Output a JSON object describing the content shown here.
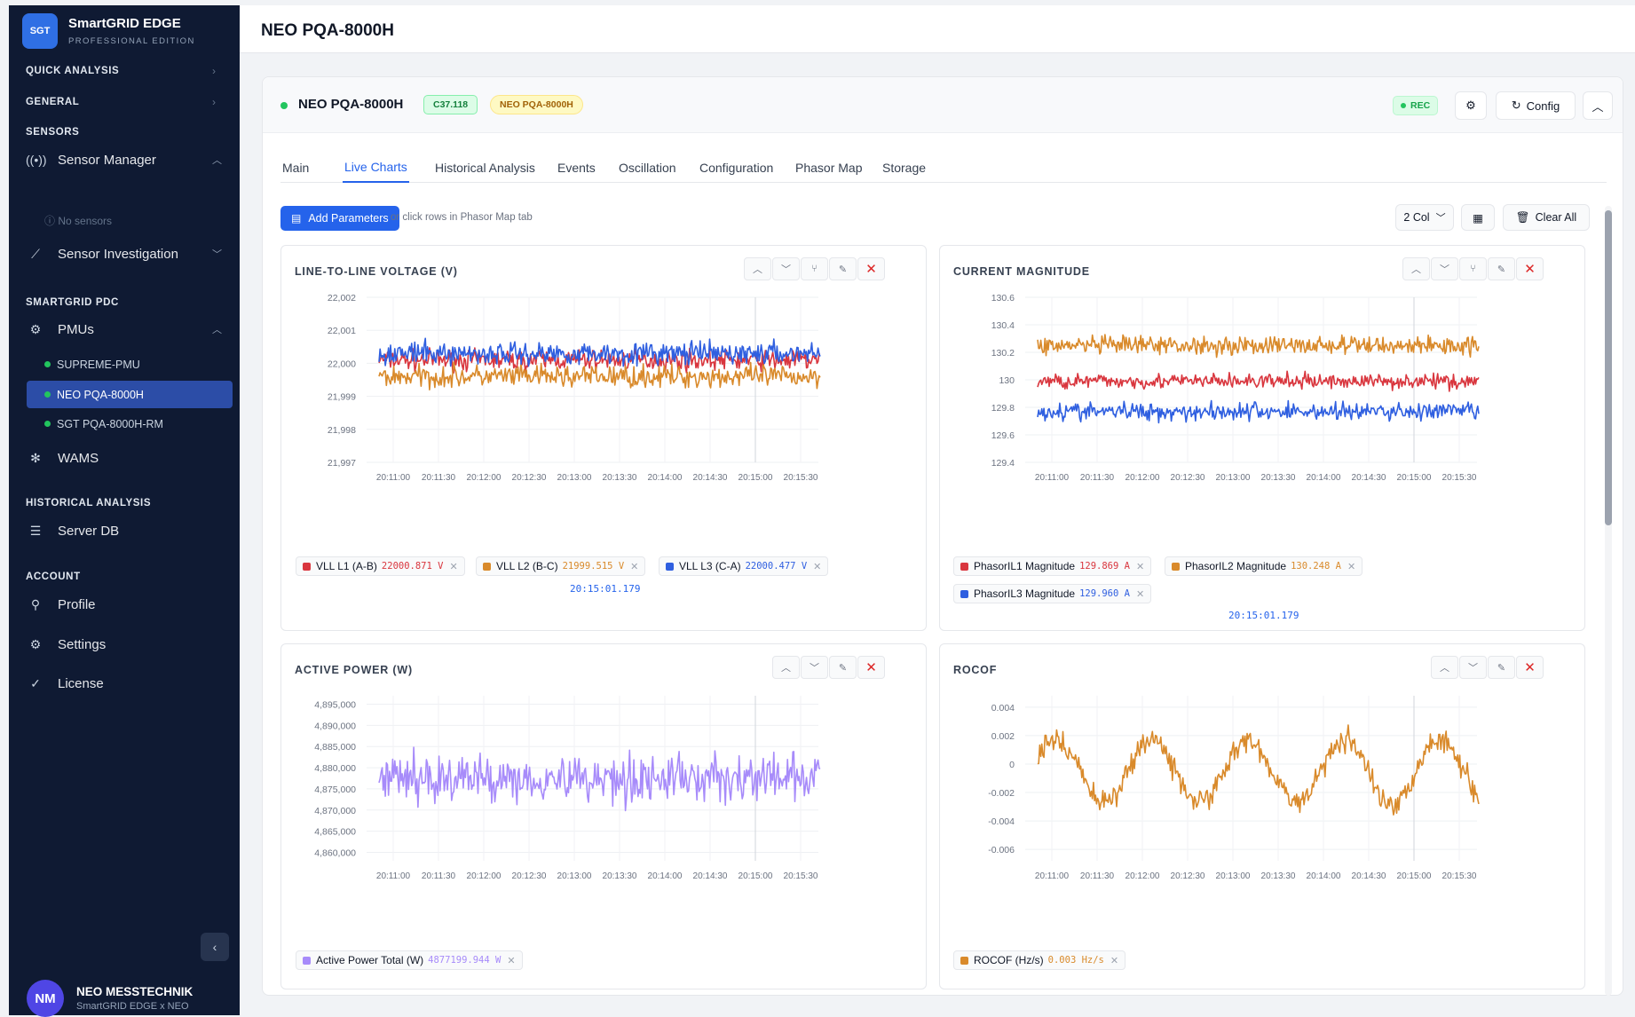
{
  "brand": {
    "logo": "SGT",
    "name": "SmartGRID EDGE",
    "edition": "PROFESSIONAL EDITION"
  },
  "sidebar": {
    "quick_analysis": "QUICK ANALYSIS",
    "general": "GENERAL",
    "sensors_header": "SENSORS",
    "sensor_manager": "Sensor Manager",
    "no_sensors": "No sensors",
    "sensor_investigation": "Sensor Investigation",
    "pdc_header": "SMARTGRID PDC",
    "pmus": "PMUs",
    "pmu_items": [
      "SUPREME-PMU",
      "NEO PQA-8000H",
      "SGT PQA-8000H-RM"
    ],
    "wams": "WAMS",
    "hist_header": "HISTORICAL ANALYSIS",
    "server_db": "Server DB",
    "account_header": "ACCOUNT",
    "profile": "Profile",
    "settings": "Settings",
    "license": "License"
  },
  "user": {
    "initials": "NM",
    "name": "NEO MESSTECHNIK",
    "subtitle": "SmartGRID EDGE x NEO"
  },
  "header": {
    "title": "NEO PQA-8000H"
  },
  "device": {
    "name": "NEO PQA-8000H",
    "protocol_badge": "C37.118",
    "device_badge": "NEO PQA-8000H",
    "rec": "REC",
    "config": "Config"
  },
  "tabs": [
    "Main",
    "Live Charts",
    "Historical Analysis",
    "Events",
    "Oscillation",
    "Configuration",
    "Phasor Map",
    "Storage"
  ],
  "active_tab": "Live Charts",
  "toolbar": {
    "add_parameters": "Add Parameters",
    "hint": "or click rows in Phasor Map tab",
    "columns": "2 Col",
    "clear_all": "Clear All"
  },
  "x_ticks": [
    "20:11:00",
    "20:11:30",
    "20:12:00",
    "20:12:30",
    "20:13:00",
    "20:13:30",
    "20:14:00",
    "20:14:30",
    "20:15:00",
    "20:15:30"
  ],
  "colors": {
    "red": "#d9363e",
    "orange": "#d98a2b",
    "blue": "#2f5fe0",
    "purple": "#a78bfa",
    "accent": "#2563eb"
  },
  "chart_data": [
    {
      "type": "line",
      "title": "LINE-TO-LINE VOLTAGE (V)",
      "ylim": [
        21997,
        22002
      ],
      "y_ticks": [
        "22,002",
        "22,001",
        "22,000",
        "21,999",
        "21,998",
        "21,997"
      ],
      "series": [
        {
          "name": "VLL L1 (A-B)",
          "value": "22000.871",
          "unit": "V",
          "color": "#d9363e",
          "center": 22000.1,
          "spread": 0.45
        },
        {
          "name": "VLL L2 (B-C)",
          "value": "21999.515",
          "unit": "V",
          "color": "#d98a2b",
          "center": 21999.6,
          "spread": 0.5
        },
        {
          "name": "VLL L3 (C-A)",
          "value": "22000.477",
          "unit": "V",
          "color": "#2f5fe0",
          "center": 22000.3,
          "spread": 0.5
        }
      ],
      "timestamp": "20:15:01.179"
    },
    {
      "type": "line",
      "title": "CURRENT MAGNITUDE",
      "ylim": [
        129.4,
        130.6
      ],
      "y_ticks": [
        "130.6",
        "130.4",
        "130.2",
        "130",
        "129.8",
        "129.6",
        "129.4"
      ],
      "series": [
        {
          "name": "PhasorIL1 Magnitude",
          "value": "129.869",
          "unit": "A",
          "color": "#d9363e",
          "center": 129.99,
          "spread": 0.08
        },
        {
          "name": "PhasorIL2 Magnitude",
          "value": "130.248",
          "unit": "A",
          "color": "#d98a2b",
          "center": 130.25,
          "spread": 0.1
        },
        {
          "name": "PhasorIL3 Magnitude",
          "value": "129.960",
          "unit": "A",
          "color": "#2f5fe0",
          "center": 129.77,
          "spread": 0.1
        }
      ],
      "timestamp": "20:15:01.179"
    },
    {
      "type": "line",
      "title": "ACTIVE POWER (W)",
      "ylim": [
        4858000,
        4897000
      ],
      "y_ticks": [
        "4,895,000",
        "4,890,000",
        "4,885,000",
        "4,880,000",
        "4,875,000",
        "4,870,000",
        "4,865,000",
        "4,860,000"
      ],
      "series": [
        {
          "name": "Active Power Total (W)",
          "value": "4877199.944",
          "unit": "W",
          "color": "#a78bfa",
          "center": 4877500,
          "spread": 8500
        }
      ]
    },
    {
      "type": "line",
      "title": "ROCOF",
      "ylim": [
        -0.0068,
        0.0048
      ],
      "y_ticks": [
        "0.004",
        "0.002",
        "0",
        "-0.002",
        "-0.004",
        "-0.006"
      ],
      "series": [
        {
          "name": "ROCOF (Hz/s)",
          "value": "0.003",
          "unit": "Hz/s",
          "color": "#d98a2b",
          "center": -0.0005,
          "spread": 0.0012,
          "wave": 0.0022
        }
      ]
    }
  ]
}
